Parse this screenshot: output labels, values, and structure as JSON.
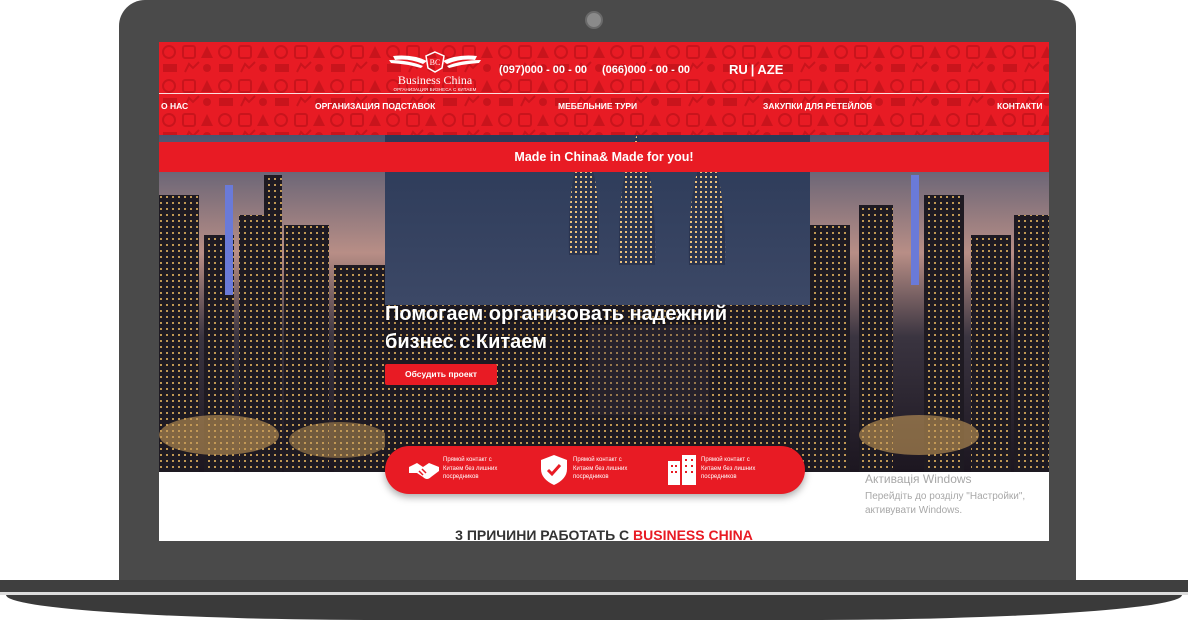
{
  "header": {
    "logo": {
      "name": "Business China",
      "tagline": "ОРГАНИЗАЦИЯ БИЗНЕСА С КИТАЕМ",
      "monogram": "BC"
    },
    "phones": [
      "(097)000 - 00 - 00",
      "(066)000 - 00 - 00"
    ],
    "languages": [
      "RU",
      "AZE"
    ],
    "nav": [
      "О НАС",
      "ОРГАНИЗАЦИЯ ПОДСТАВОК",
      "МЕБЕЛЬНИЕ ТУРИ",
      "ЗАКУПКИ ДЛЯ РЕТЕЙЛОВ",
      "КОНТАКТИ"
    ]
  },
  "banner": {
    "text": "Made in China& Made for you!"
  },
  "hero": {
    "title_line1": "Помогаем организовать надежний",
    "title_line2": "бизнес с Китаем",
    "cta": "Обсудить проект"
  },
  "features": [
    {
      "icon": "handshake-icon",
      "text": "Прямой контакт с Китаем без лишних посредников"
    },
    {
      "icon": "shield-check-icon",
      "text": "Прямой контакт с Китаем без лишних посредников"
    },
    {
      "icon": "buildings-icon",
      "text": "Прямой контакт с Китаем без лишних посредников"
    }
  ],
  "watermark": {
    "title": "Активація Windows",
    "line1": "Перейдіть до розділу \"Настройки\",",
    "line2": "активувати Windows."
  },
  "reasons": {
    "prefix": "3 ПРИЧИНИ РАБОТАТЬ С",
    "brand": "BUSINESS CHINA"
  },
  "colors": {
    "brand_red": "#e81b24",
    "frame": "#4a4a4a"
  }
}
